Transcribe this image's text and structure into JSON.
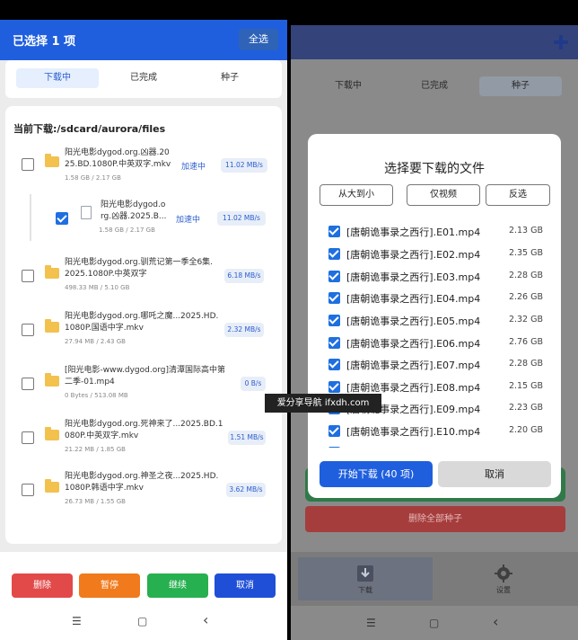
{
  "left": {
    "header": {
      "title": "已选择 1 项",
      "select_all": "全选"
    },
    "tabs": [
      {
        "label": "下载中",
        "active": true
      },
      {
        "label": "已完成",
        "active": false
      },
      {
        "label": "种子",
        "active": false
      }
    ],
    "path_label": "当前下载:/sdcard/aurora/files",
    "items": [
      {
        "name1": "阳光电影dygod.org.凶器.20",
        "name2": "25.BD.1080P.中英双字.mkv",
        "size": "1.58 GB / 2.17 GB",
        "status": "加速中",
        "speed": "11.02 MB/s",
        "checked": false,
        "type": "folder"
      },
      {
        "name1": "阳光电影dygod.o",
        "name2": "rg.凶器.2025.B...",
        "size": "1.58 GB / 2.17 GB",
        "status": "加速中",
        "speed": "11.02 MB/s",
        "checked": true,
        "type": "file"
      },
      {
        "name1": "阳光电影dygod.org.驯荒记第一季全6集.",
        "name2": "2025.1080P.中英双字",
        "size": "498.33 MB / 5.10 GB",
        "status": "",
        "speed": "6.18 MB/s",
        "checked": false,
        "type": "folder"
      },
      {
        "name1": "阳光电影dygod.org.哪吒之魔...2025.HD.",
        "name2": "1080P.国语中字.mkv",
        "size": "27.94 MB / 2.43 GB",
        "status": "",
        "speed": "2.32 MB/s",
        "checked": false,
        "type": "folder"
      },
      {
        "name1": "[阳光电影-www.dygod.org]清潭国际高中第",
        "name2": "二季-01.mp4",
        "size": "0 Bytes / 513.08 MB",
        "status": "",
        "speed": "0 B/s",
        "checked": false,
        "type": "folder"
      },
      {
        "name1": "阳光电影dygod.org.死神来了...2025.BD.1",
        "name2": "080P.中英双字.mkv",
        "size": "21.22 MB / 1.85 GB",
        "status": "",
        "speed": "1.51 MB/s",
        "checked": false,
        "type": "folder"
      },
      {
        "name1": "阳光电影dygod.org.神圣之夜...2025.HD.",
        "name2": "1080P.韩语中字.mkv",
        "size": "26.73 MB / 1.55 GB",
        "status": "",
        "speed": "3.62 MB/s",
        "checked": false,
        "type": "folder"
      }
    ],
    "buttons": {
      "delete": "删除",
      "pause": "暂停",
      "resume": "继续",
      "cancel": "取消"
    },
    "nav": {
      "menu": "☰",
      "home": "▢",
      "back": "‹"
    }
  },
  "right": {
    "tabs": [
      {
        "label": "下载中",
        "active": false
      },
      {
        "label": "已完成",
        "active": false
      },
      {
        "label": "种子",
        "active": true
      }
    ],
    "delete_all": "删除全部种子",
    "bottom_nav": {
      "download": "下载",
      "settings": "设置"
    },
    "nav": {
      "menu": "☰",
      "home": "▢",
      "back": "‹"
    }
  },
  "dialog": {
    "title": "选择要下载的文件",
    "options": {
      "sort": "从大到小",
      "video_only": "仅视频",
      "invert": "反选"
    },
    "files": [
      {
        "name": "[唐朝诡事录之西行].E01.mp4",
        "size": "2.13 GB"
      },
      {
        "name": "[唐朝诡事录之西行].E02.mp4",
        "size": "2.35 GB"
      },
      {
        "name": "[唐朝诡事录之西行].E03.mp4",
        "size": "2.28 GB"
      },
      {
        "name": "[唐朝诡事录之西行].E04.mp4",
        "size": "2.26 GB"
      },
      {
        "name": "[唐朝诡事录之西行].E05.mp4",
        "size": "2.32 GB"
      },
      {
        "name": "[唐朝诡事录之西行].E06.mp4",
        "size": "2.76 GB"
      },
      {
        "name": "[唐朝诡事录之西行].E07.mp4",
        "size": "2.28 GB"
      },
      {
        "name": "[唐朝诡事录之西行].E08.mp4",
        "size": "2.15 GB"
      },
      {
        "name": "[唐朝诡事录之西行].E09.mp4",
        "size": "2.23 GB"
      },
      {
        "name": "[唐朝诡事录之西行].E10.mp4",
        "size": "2.20 GB"
      }
    ],
    "start_button": "开始下载 (40 项)",
    "cancel_button": "取消"
  },
  "watermark": "爱分享导航 ifxdh.com"
}
